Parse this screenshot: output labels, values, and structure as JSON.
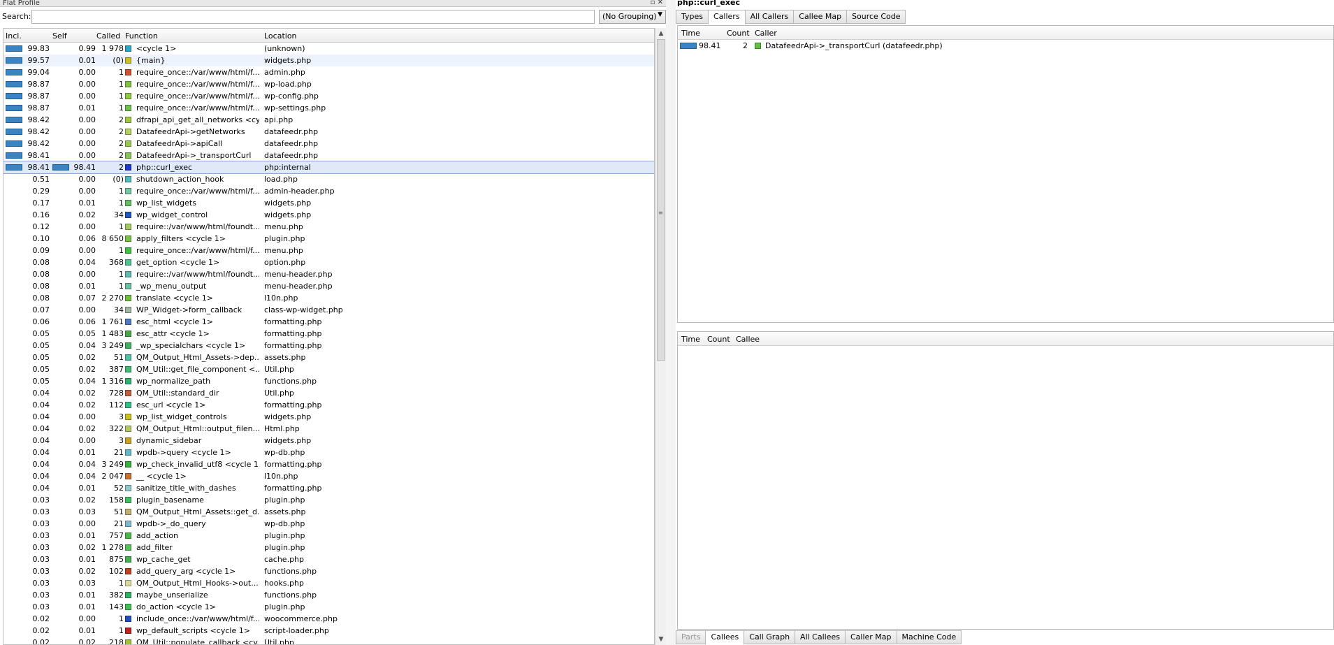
{
  "left_title": "Flat Profile",
  "search": {
    "label": "Search:",
    "value": "",
    "grouping": "(No Grouping)"
  },
  "columns": {
    "incl": "Incl.",
    "self": "Self",
    "called": "Called",
    "function": "Function",
    "location": "Location"
  },
  "rows": [
    {
      "incl": "99.83",
      "self": "0.99",
      "called": "1 978",
      "func": "<cycle 1>",
      "loc": "(unknown)",
      "color": "#2aa8c8",
      "bar": 0.9983
    },
    {
      "incl": "99.57",
      "self": "0.01",
      "called": "(0)",
      "func": "{main}",
      "loc": "widgets.php",
      "color": "#c8c020",
      "bar": 0.9957
    },
    {
      "incl": "99.04",
      "self": "0.00",
      "called": "1",
      "func": "require_once::/var/www/html/f...",
      "loc": "admin.php",
      "color": "#d05030",
      "bar": 0.9904
    },
    {
      "incl": "98.87",
      "self": "0.00",
      "called": "1",
      "func": "require_once::/var/www/html/f...",
      "loc": "wp-load.php",
      "color": "#80c040",
      "bar": 0.9887
    },
    {
      "incl": "98.87",
      "self": "0.00",
      "called": "1",
      "func": "require_once::/var/www/html/f...",
      "loc": "wp-config.php",
      "color": "#90c840",
      "bar": 0.9887
    },
    {
      "incl": "98.87",
      "self": "0.01",
      "called": "1",
      "func": "require_once::/var/www/html/f...",
      "loc": "wp-settings.php",
      "color": "#70c050",
      "bar": 0.9887
    },
    {
      "incl": "98.42",
      "self": "0.00",
      "called": "2",
      "func": "dfrapi_api_get_all_networks <cy...",
      "loc": "api.php",
      "color": "#a0c840",
      "bar": 0.9842
    },
    {
      "incl": "98.42",
      "self": "0.00",
      "called": "2",
      "func": "DatafeedrApi->getNetworks",
      "loc": "datafeedr.php",
      "color": "#b0d060",
      "bar": 0.9842
    },
    {
      "incl": "98.42",
      "self": "0.00",
      "called": "2",
      "func": "DatafeedrApi->apiCall",
      "loc": "datafeedr.php",
      "color": "#98c850",
      "bar": 0.9842
    },
    {
      "incl": "98.41",
      "self": "0.00",
      "called": "2",
      "func": "DatafeedrApi->_transportCurl",
      "loc": "datafeedr.php",
      "color": "#88c060",
      "bar": 0.9841
    },
    {
      "incl": "98.41",
      "self": "98.41",
      "called": "2",
      "func": "php::curl_exec",
      "loc": "php:internal",
      "color": "#2038c8",
      "bar": 0.9841,
      "selfbar": 0.9841
    },
    {
      "incl": "0.51",
      "self": "0.00",
      "called": "(0)",
      "func": "shutdown_action_hook",
      "loc": "load.php",
      "color": "#50b8b8"
    },
    {
      "incl": "0.29",
      "self": "0.00",
      "called": "1",
      "func": "require_once::/var/www/html/f...",
      "loc": "admin-header.php",
      "color": "#70c8a0"
    },
    {
      "incl": "0.17",
      "self": "0.01",
      "called": "1",
      "func": "wp_list_widgets",
      "loc": "widgets.php",
      "color": "#60c060"
    },
    {
      "incl": "0.16",
      "self": "0.02",
      "called": "34",
      "func": "wp_widget_control",
      "loc": "widgets.php",
      "color": "#2058b8"
    },
    {
      "incl": "0.12",
      "self": "0.00",
      "called": "1",
      "func": "require::/var/www/html/foundt...",
      "loc": "menu.php",
      "color": "#a0c860"
    },
    {
      "incl": "0.10",
      "self": "0.06",
      "called": "8 650",
      "func": "apply_filters <cycle 1>",
      "loc": "plugin.php",
      "color": "#78c040"
    },
    {
      "incl": "0.09",
      "self": "0.00",
      "called": "1",
      "func": "require_once::/var/www/html/f...",
      "loc": "menu.php",
      "color": "#40c040"
    },
    {
      "incl": "0.08",
      "self": "0.04",
      "called": "368",
      "func": "get_option <cycle 1>",
      "loc": "option.php",
      "color": "#50c090"
    },
    {
      "incl": "0.08",
      "self": "0.00",
      "called": "1",
      "func": "require::/var/www/html/foundt...",
      "loc": "menu-header.php",
      "color": "#60b8b0"
    },
    {
      "incl": "0.08",
      "self": "0.01",
      "called": "1",
      "func": "_wp_menu_output",
      "loc": "menu-header.php",
      "color": "#68c0a0"
    },
    {
      "incl": "0.08",
      "self": "0.07",
      "called": "2 270",
      "func": "translate <cycle 1>",
      "loc": "l10n.php",
      "color": "#70c040"
    },
    {
      "incl": "0.07",
      "self": "0.00",
      "called": "34",
      "func": "WP_Widget->form_callback",
      "loc": "class-wp-widget.php",
      "color": "#a0b8a0"
    },
    {
      "incl": "0.06",
      "self": "0.06",
      "called": "1 761",
      "func": "esc_html <cycle 1>",
      "loc": "formatting.php",
      "color": "#5078c0"
    },
    {
      "incl": "0.05",
      "self": "0.05",
      "called": "1 483",
      "func": "esc_attr <cycle 1>",
      "loc": "formatting.php",
      "color": "#48a848"
    },
    {
      "incl": "0.05",
      "self": "0.04",
      "called": "3 249",
      "func": "_wp_specialchars <cycle 1>",
      "loc": "formatting.php",
      "color": "#40b060"
    },
    {
      "incl": "0.05",
      "self": "0.02",
      "called": "51",
      "func": "QM_Output_Html_Assets->dep...",
      "loc": "assets.php",
      "color": "#50c0a0"
    },
    {
      "incl": "0.05",
      "self": "0.02",
      "called": "387",
      "func": "QM_Util::get_file_component <...",
      "loc": "Util.php",
      "color": "#40b870"
    },
    {
      "incl": "0.05",
      "self": "0.04",
      "called": "1 316",
      "func": "wp_normalize_path",
      "loc": "functions.php",
      "color": "#30b070"
    },
    {
      "incl": "0.04",
      "self": "0.02",
      "called": "728",
      "func": "QM_Util::standard_dir",
      "loc": "Util.php",
      "color": "#c06040"
    },
    {
      "incl": "0.04",
      "self": "0.02",
      "called": "112",
      "func": "esc_url <cycle 1>",
      "loc": "formatting.php",
      "color": "#30c080"
    },
    {
      "incl": "0.04",
      "self": "0.00",
      "called": "3",
      "func": "wp_list_widget_controls",
      "loc": "widgets.php",
      "color": "#c8c020"
    },
    {
      "incl": "0.04",
      "self": "0.02",
      "called": "322",
      "func": "QM_Output_Html::output_filen...",
      "loc": "Html.php",
      "color": "#b0c860"
    },
    {
      "incl": "0.04",
      "self": "0.00",
      "called": "3",
      "func": "dynamic_sidebar",
      "loc": "widgets.php",
      "color": "#c8a020"
    },
    {
      "incl": "0.04",
      "self": "0.01",
      "called": "21",
      "func": "wpdb->query <cycle 1>",
      "loc": "wp-db.php",
      "color": "#60b8c8"
    },
    {
      "incl": "0.04",
      "self": "0.04",
      "called": "3 249",
      "func": "wp_check_invalid_utf8 <cycle 1>",
      "loc": "formatting.php",
      "color": "#38b040"
    },
    {
      "incl": "0.04",
      "self": "0.04",
      "called": "2 047",
      "func": "__ <cycle 1>",
      "loc": "l10n.php",
      "color": "#c87030"
    },
    {
      "incl": "0.04",
      "self": "0.01",
      "called": "52",
      "func": "sanitize_title_with_dashes",
      "loc": "formatting.php",
      "color": "#90c8c8"
    },
    {
      "incl": "0.03",
      "self": "0.02",
      "called": "158",
      "func": "plugin_basename",
      "loc": "plugin.php",
      "color": "#40c060"
    },
    {
      "incl": "0.03",
      "self": "0.03",
      "called": "51",
      "func": "QM_Output_Html_Assets::get_d...",
      "loc": "assets.php",
      "color": "#c0b070"
    },
    {
      "incl": "0.03",
      "self": "0.00",
      "called": "21",
      "func": "wpdb->_do_query",
      "loc": "wp-db.php",
      "color": "#80b8d0"
    },
    {
      "incl": "0.03",
      "self": "0.01",
      "called": "757",
      "func": "add_action",
      "loc": "plugin.php",
      "color": "#48b848"
    },
    {
      "incl": "0.03",
      "self": "0.02",
      "called": "1 278",
      "func": "add_filter",
      "loc": "plugin.php",
      "color": "#58c058"
    },
    {
      "incl": "0.03",
      "self": "0.01",
      "called": "875",
      "func": "wp_cache_get",
      "loc": "cache.php",
      "color": "#40b050"
    },
    {
      "incl": "0.03",
      "self": "0.02",
      "called": "102",
      "func": "add_query_arg <cycle 1>",
      "loc": "functions.php",
      "color": "#c04020"
    },
    {
      "incl": "0.03",
      "self": "0.03",
      "called": "1",
      "func": "QM_Output_Html_Hooks->out...",
      "loc": "hooks.php",
      "color": "#d8d8a0"
    },
    {
      "incl": "0.03",
      "self": "0.01",
      "called": "382",
      "func": "maybe_unserialize",
      "loc": "functions.php",
      "color": "#30b060"
    },
    {
      "incl": "0.03",
      "self": "0.01",
      "called": "143",
      "func": "do_action <cycle 1>",
      "loc": "plugin.php",
      "color": "#40c050"
    },
    {
      "incl": "0.02",
      "self": "0.00",
      "called": "1",
      "func": "include_once::/var/www/html/f...",
      "loc": "woocommerce.php",
      "color": "#2050c0"
    },
    {
      "incl": "0.02",
      "self": "0.01",
      "called": "1",
      "func": "wp_default_scripts <cycle 1>",
      "loc": "script-loader.php",
      "color": "#c02020"
    },
    {
      "incl": "0.02",
      "self": "0.02",
      "called": "218",
      "func": "QM_Util::populate_callback <cy...",
      "loc": "Util.php",
      "color": "#a0c040"
    }
  ],
  "right": {
    "title": "php::curl_exec",
    "top_tabs": [
      "Types",
      "Callers",
      "All Callers",
      "Callee Map",
      "Source Code"
    ],
    "top_active": 1,
    "callers_head": {
      "time": "Time",
      "count": "Count",
      "caller": "Caller"
    },
    "callers": [
      {
        "time": "98.41",
        "count": "2",
        "caller": "DatafeedrApi->_transportCurl (datafeedr.php)",
        "color": "#60c040",
        "bar": 0.9841
      }
    ],
    "callees_head": {
      "time": "Time",
      "count": "Count",
      "callee": "Callee"
    },
    "bottom_tabs": [
      "Parts",
      "Callees",
      "Call Graph",
      "All Callees",
      "Caller Map",
      "Machine Code"
    ],
    "bottom_active": 1,
    "bottom_disabled": 0
  }
}
